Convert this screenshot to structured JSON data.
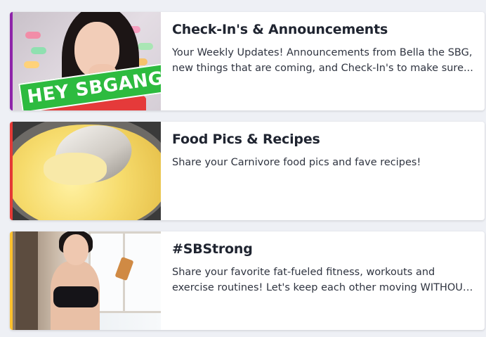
{
  "cards": [
    {
      "title": "Check-In's & Announcements",
      "description": "Your Weekly Updates! Announcements from Bella the SBG, new things that are coming, and Check-In's to make sure...",
      "accent_color": "#8e24aa",
      "image_banner": "HEY SBGANG!"
    },
    {
      "title": "Food Pics & Recipes",
      "description": "Share your Carnivore food pics and fave recipes!",
      "accent_color": "#e53935"
    },
    {
      "title": "#SBStrong",
      "description": "Share your favorite fat-fueled fitness, workouts and exercise routines! Let's keep each other moving WITHOUT the...",
      "accent_color": "#fbc02d"
    }
  ]
}
